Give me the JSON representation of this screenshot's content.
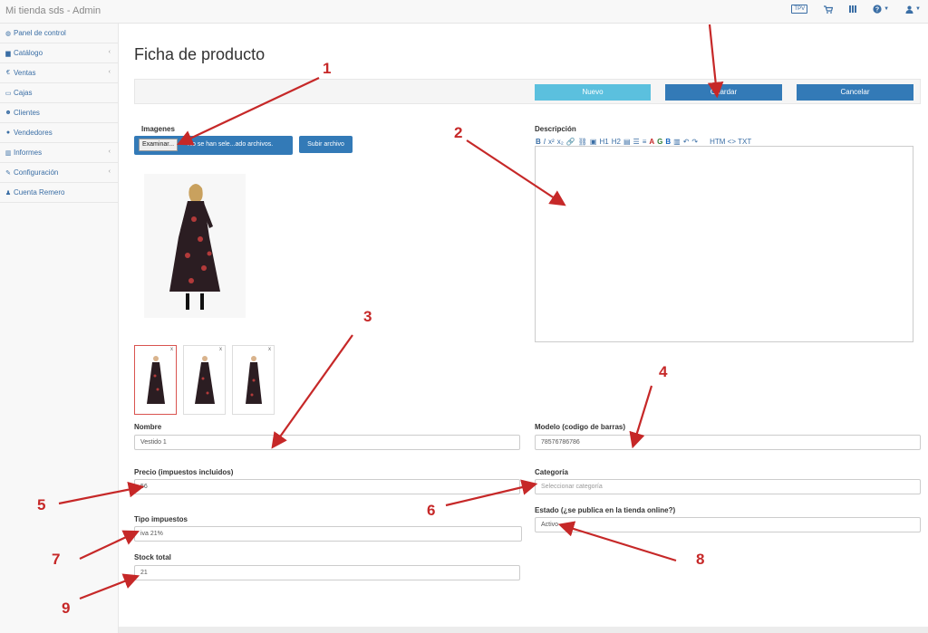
{
  "app": {
    "title": "Mi tienda sds - Admin",
    "top_icons": [
      {
        "name": "tpv-icon",
        "label": "TPV"
      },
      {
        "name": "cart-icon"
      },
      {
        "name": "barcode-icon"
      },
      {
        "name": "help-icon"
      },
      {
        "name": "user-icon"
      }
    ]
  },
  "sidebar": {
    "items": [
      {
        "label": "Panel de control",
        "icon": "dashboard-icon",
        "has_children": false
      },
      {
        "label": "Catálogo",
        "icon": "book-icon",
        "has_children": true
      },
      {
        "label": "Ventas",
        "icon": "euro-icon",
        "has_children": true
      },
      {
        "label": "Cajas",
        "icon": "register-icon",
        "has_children": false
      },
      {
        "label": "Clientes",
        "icon": "users-icon",
        "has_children": false
      },
      {
        "label": "Vendedores",
        "icon": "seller-icon",
        "has_children": false
      },
      {
        "label": "Informes",
        "icon": "chart-icon",
        "has_children": true
      },
      {
        "label": "Configuración",
        "icon": "wrench-icon",
        "has_children": true
      },
      {
        "label": "Cuenta Remero",
        "icon": "account-icon",
        "has_children": false
      }
    ]
  },
  "page": {
    "title": "Ficha de producto"
  },
  "actions": {
    "new_label": "Nuevo",
    "save_label": "Guardar",
    "cancel_label": "Cancelar"
  },
  "images": {
    "label": "Imagenes",
    "browse_label": "Examinar...",
    "file_status": "No se han sele...ado archivos.",
    "upload_label": "Subir archivo",
    "thumb_close": "x"
  },
  "description": {
    "label": "Descripción",
    "toolbar": [
      "B",
      "I",
      "x²",
      "x₂",
      "🔗",
      "⛓",
      "▣",
      "H1",
      "H2",
      "▤",
      "☰",
      "≡",
      "A",
      "G",
      "B",
      "▥",
      "↶",
      "↷"
    ],
    "html_toggle": "HTM <> TXT"
  },
  "fields": {
    "name_label": "Nombre",
    "name_value": "Vestido 1",
    "model_label": "Modelo (codigo de barras)",
    "model_value": "78576786786",
    "price_label": "Precio (impuestos incluidos)",
    "price_value": "56",
    "category_label": "Categoría",
    "category_placeholder": "Seleccionar categoría",
    "tax_label": "Tipo impuestos",
    "tax_value": "iva 21%",
    "status_label": "Estado (¿se publica en la tienda online?)",
    "status_value": "Activo",
    "stock_label": "Stock total",
    "stock_value": "21"
  },
  "annotations": [
    "1",
    "2",
    "3",
    "4",
    "5",
    "6",
    "7",
    "8",
    "9"
  ],
  "colors": {
    "primary": "#337ab7",
    "info": "#5bc0de",
    "annotation": "#c62828",
    "dress": "#2b1d22",
    "flower": "#b23a3a"
  }
}
